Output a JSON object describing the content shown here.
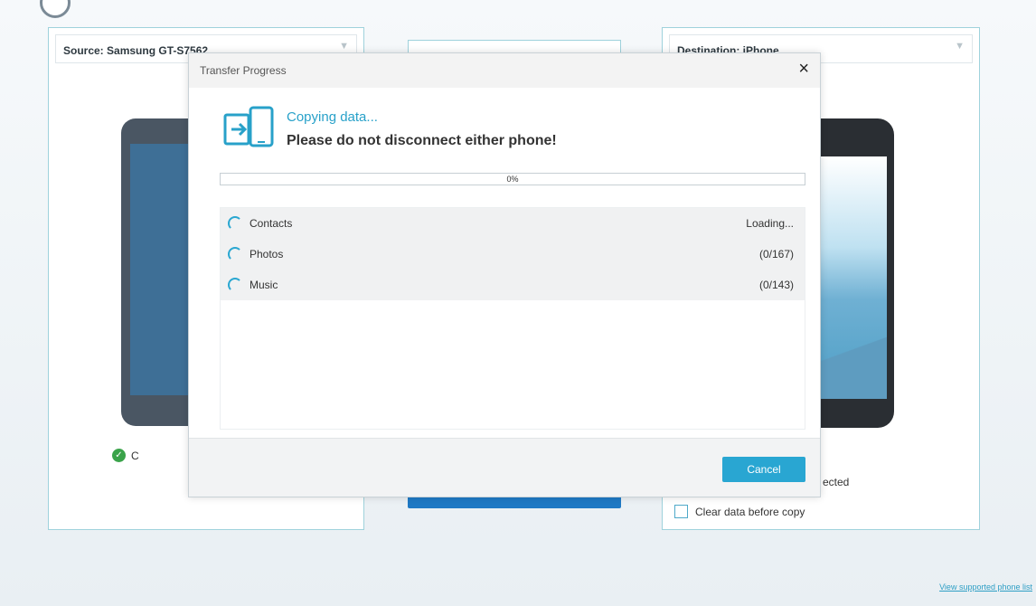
{
  "source_panel": {
    "header": "Source: Samsung GT-S7562",
    "connected_text": "C"
  },
  "destination_panel": {
    "header": "Destination: iPhone",
    "connected_text": "ected",
    "clear_data_label": "Clear data before copy"
  },
  "footer": {
    "supported_link": "View supported phone list"
  },
  "dialog": {
    "title": "Transfer Progress",
    "close_symbol": "×",
    "copying_text": "Copying data...",
    "warning_text": "Please do not disconnect either phone!",
    "progress": {
      "value": 0,
      "label": "0%"
    },
    "items": [
      {
        "name": "Contacts",
        "status": "Loading..."
      },
      {
        "name": "Photos",
        "status": "(0/167)"
      },
      {
        "name": "Music",
        "status": "(0/143)"
      }
    ],
    "cancel_label": "Cancel"
  },
  "colors": {
    "accent": "#29a6d2",
    "primary_button": "#1f79c4",
    "connected_check": "#3aa34a"
  },
  "icons": {
    "app_logo": "circle-logo-icon",
    "copy": "phone-transfer-icon",
    "close": "close-icon",
    "check": "check-circle-icon",
    "spinner": "loading-spinner-icon"
  }
}
